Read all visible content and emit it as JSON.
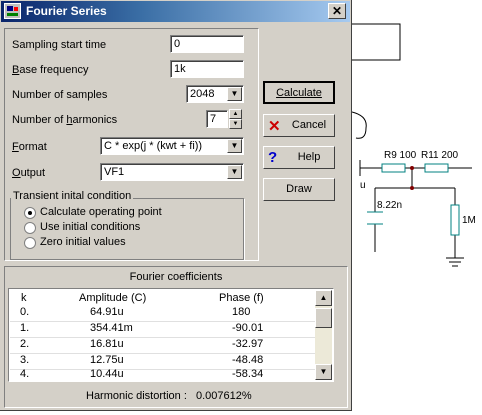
{
  "window": {
    "title": "Fourier Series",
    "close_glyph": "✕"
  },
  "fields": {
    "sampling_start_label": "Sampling start time",
    "sampling_start_value": "0",
    "base_freq_label_u": "B",
    "base_freq_label_rest": "ase frequency",
    "base_freq_value": "1k",
    "num_samples_label": "Number of samples",
    "num_samples_value": "2048",
    "num_harmonics_label_pre": "Number of ",
    "num_harmonics_label_u": "h",
    "num_harmonics_label_post": "armonics",
    "num_harmonics_value": "7",
    "format_label_u": "F",
    "format_label_rest": "ormat",
    "format_value": "C * exp(j * (kwt + fi))",
    "output_label_u": "O",
    "output_label_rest": "utput",
    "output_value": "VF1"
  },
  "transient": {
    "title": "Transient inital condition",
    "options": [
      "Calculate operating point",
      "Use initial conditions",
      "Zero initial values"
    ],
    "selected_index": 0
  },
  "buttons": {
    "calculate": "Calculate",
    "cancel": "Cancel",
    "help": "Help",
    "draw": "Draw"
  },
  "fourier": {
    "title": "Fourier coefficients",
    "columns": [
      "k",
      "Amplitude (C)",
      "Phase (f)"
    ],
    "rows": [
      {
        "k": "0.",
        "amp": "64.91u",
        "phase": "180"
      },
      {
        "k": "1.",
        "amp": "354.41m",
        "phase": "-90.01"
      },
      {
        "k": "2.",
        "amp": "16.81u",
        "phase": "-32.97"
      },
      {
        "k": "3.",
        "amp": "12.75u",
        "phase": "-48.48"
      },
      {
        "k": "4.",
        "amp": "10.44u",
        "phase": "-58.34"
      }
    ],
    "distortion_label": "Harmonic distortion :",
    "distortion_value": "0.007612%"
  },
  "schematic": {
    "r9": "R9 100",
    "r11": "R11 200",
    "cap": "8.22n",
    "r_1m": "1M",
    "u_label": "u"
  },
  "colors": {
    "title_start": "#0a246a",
    "title_end": "#a6caf0",
    "wire": "#000000",
    "component": "#008080",
    "cancel_x": "#cc0000",
    "help_q": "#0000cc"
  }
}
